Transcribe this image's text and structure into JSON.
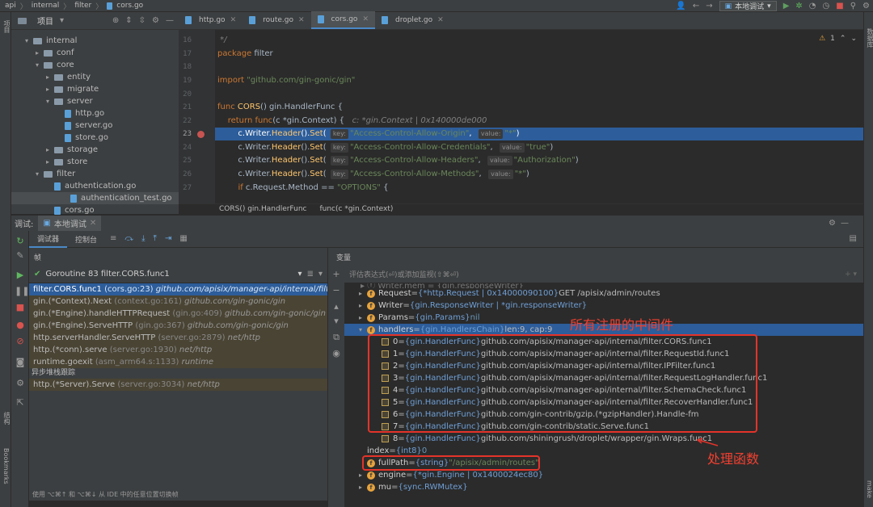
{
  "topbar": {
    "crumbs": [
      "api",
      "internal",
      "filter",
      "cors.go"
    ],
    "run_config": "本地调试"
  },
  "left_strip": {
    "project": "项目",
    "structure": "结构",
    "bookmarks": "Bookmarks"
  },
  "right_strip": {
    "database": "数据库",
    "make": "make"
  },
  "project": {
    "title": "项目",
    "tree": [
      {
        "label": "internal",
        "type": "folder",
        "indent": 1,
        "expanded": true
      },
      {
        "label": "conf",
        "type": "folder",
        "indent": 2,
        "expanded": false
      },
      {
        "label": "core",
        "type": "folder",
        "indent": 2,
        "expanded": true
      },
      {
        "label": "entity",
        "type": "folder",
        "indent": 3,
        "expanded": false
      },
      {
        "label": "migrate",
        "type": "folder",
        "indent": 3,
        "expanded": false
      },
      {
        "label": "server",
        "type": "folder",
        "indent": 3,
        "expanded": true
      },
      {
        "label": "http.go",
        "type": "file",
        "indent": 4
      },
      {
        "label": "server.go",
        "type": "file",
        "indent": 4
      },
      {
        "label": "store.go",
        "type": "file",
        "indent": 4
      },
      {
        "label": "storage",
        "type": "folder",
        "indent": 3,
        "expanded": false
      },
      {
        "label": "store",
        "type": "folder",
        "indent": 3,
        "expanded": false
      },
      {
        "label": "filter",
        "type": "folder",
        "indent": 2,
        "expanded": true
      },
      {
        "label": "authentication.go",
        "type": "file",
        "indent": 3
      },
      {
        "label": "authentication_test.go",
        "type": "file",
        "indent": 3,
        "selected": true
      },
      {
        "label": "cors.go",
        "type": "file",
        "indent": 3
      }
    ]
  },
  "editor": {
    "tabs": [
      {
        "label": "http.go",
        "active": false
      },
      {
        "label": "route.go",
        "active": false
      },
      {
        "label": "cors.go",
        "active": true
      },
      {
        "label": "droplet.go",
        "active": false
      }
    ],
    "warning_count": "1",
    "lines": [
      16,
      17,
      18,
      19,
      20,
      21,
      22,
      23,
      24,
      25,
      26,
      27
    ],
    "breadcrumb": [
      "CORS() gin.HandlerFunc",
      "func(c *gin.Context)"
    ]
  },
  "debug": {
    "label": "调试:",
    "session": "本地调试",
    "tabs": [
      "调试器",
      "控制台"
    ],
    "frames_label": "帧",
    "vars_label": "变量",
    "goroutine": "Goroutine 83 filter.CORS.func1",
    "frames": [
      {
        "fn": "filter.CORS.func1",
        "loc": "(cors.go:23)",
        "path": "github.com/apisix/manager-api/internal/filter",
        "kind": "sel"
      },
      {
        "fn": "gin.(*Context).Next",
        "loc": "(context.go:161)",
        "path": "github.com/gin-gonic/gin",
        "kind": "lib"
      },
      {
        "fn": "gin.(*Engine).handleHTTPRequest",
        "loc": "(gin.go:409)",
        "path": "github.com/gin-gonic/gin",
        "kind": "lib"
      },
      {
        "fn": "gin.(*Engine).ServeHTTP",
        "loc": "(gin.go:367)",
        "path": "github.com/gin-gonic/gin",
        "kind": "lib"
      },
      {
        "fn": "http.serverHandler.ServeHTTP",
        "loc": "(server.go:2879)",
        "path": "net/http",
        "kind": "lib"
      },
      {
        "fn": "http.(*conn).serve",
        "loc": "(server.go:1930)",
        "path": "net/http",
        "kind": "lib"
      },
      {
        "fn": "runtime.goexit",
        "loc": "(asm_arm64.s:1133)",
        "path": "runtime",
        "kind": "lib"
      }
    ],
    "async_label": "异步堆栈跟踪",
    "async_frames": [
      {
        "fn": "http.(*Server).Serve",
        "loc": "(server.go:3034)",
        "path": "net/http"
      }
    ],
    "footer_hint": "使用 ⌥⌘↑ 和 ⌥⌘↓ 从 IDE 中的任意位置切换帧",
    "eval_placeholder": "评估表达式(⏎)或添加监视(⇧⌘⏎)",
    "variables": [
      {
        "name": "Request",
        "type": "{*http.Request | 0x14000090100}",
        "value": "GET /apisix/admin/routes",
        "expanded": false
      },
      {
        "name": "Writer",
        "type": "{gin.ResponseWriter | *gin.responseWriter}",
        "value": "",
        "expanded": false
      },
      {
        "name": "Params",
        "type": "{gin.Params}",
        "value": "nil",
        "expanded": false
      },
      {
        "name": "handlers",
        "type": "{gin.HandlersChain}",
        "value": "len:9, cap:9",
        "expanded": true,
        "selected": true
      }
    ],
    "handlers": [
      {
        "idx": "0",
        "type": "{gin.HandlerFunc}",
        "value": "github.com/apisix/manager-api/internal/filter.CORS.func1"
      },
      {
        "idx": "1",
        "type": "{gin.HandlerFunc}",
        "value": "github.com/apisix/manager-api/internal/filter.RequestId.func1"
      },
      {
        "idx": "2",
        "type": "{gin.HandlerFunc}",
        "value": "github.com/apisix/manager-api/internal/filter.IPFilter.func1"
      },
      {
        "idx": "3",
        "type": "{gin.HandlerFunc}",
        "value": "github.com/apisix/manager-api/internal/filter.RequestLogHandler.func1"
      },
      {
        "idx": "4",
        "type": "{gin.HandlerFunc}",
        "value": "github.com/apisix/manager-api/internal/filter.SchemaCheck.func1"
      },
      {
        "idx": "5",
        "type": "{gin.HandlerFunc}",
        "value": "github.com/apisix/manager-api/internal/filter.RecoverHandler.func1"
      },
      {
        "idx": "6",
        "type": "{gin.HandlerFunc}",
        "value": "github.com/gin-contrib/gzip.(*gzipHandler).Handle-fm"
      },
      {
        "idx": "7",
        "type": "{gin.HandlerFunc}",
        "value": "github.com/gin-contrib/static.Serve.func1"
      },
      {
        "idx": "8",
        "type": "{gin.HandlerFunc}",
        "value": "github.com/shiningrush/droplet/wrapper/gin.Wraps.func1"
      }
    ],
    "after_vars": [
      {
        "name": "index",
        "type": "{int8}",
        "value": "0",
        "badge": false
      },
      {
        "name": "fullPath",
        "type": "{string}",
        "value": "\"/apisix/admin/routes\"",
        "badge": true
      },
      {
        "name": "engine",
        "type": "{*gin.Engine | 0x1400024ec80}",
        "value": "",
        "badge": true,
        "arrow": true
      },
      {
        "name": "mu",
        "type": "{sync.RWMutex}",
        "value": "",
        "badge": true,
        "arrow": true
      }
    ]
  },
  "annotations": {
    "middleware": "所有注册的中间件",
    "handler": "处理函数"
  }
}
